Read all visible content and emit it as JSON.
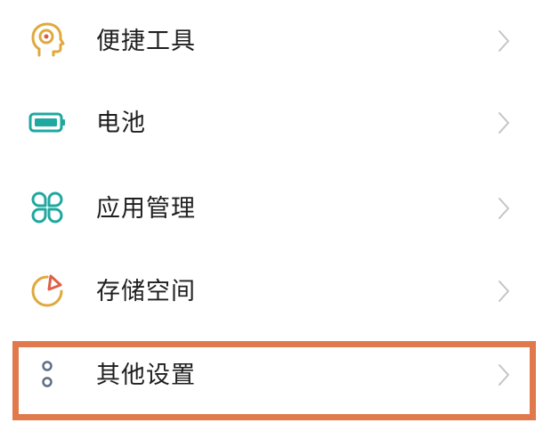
{
  "settings": {
    "items": [
      {
        "label": "便捷工具",
        "icon": "shortcut-tools-icon",
        "icon_color": "#e0a93c"
      },
      {
        "label": "电池",
        "icon": "battery-icon",
        "icon_color": "#1fa8a0"
      },
      {
        "label": "应用管理",
        "icon": "app-management-icon",
        "icon_color": "#1fa8a0"
      },
      {
        "label": "存储空间",
        "icon": "storage-icon",
        "icon_color": "#e0a93c"
      },
      {
        "label": "其他设置",
        "icon": "more-settings-icon",
        "icon_color": "#5f6f86"
      }
    ],
    "chevron_color": "#c4c4c4",
    "highlight_color": "#e07a4c",
    "highlighted_item": "其他设置"
  }
}
